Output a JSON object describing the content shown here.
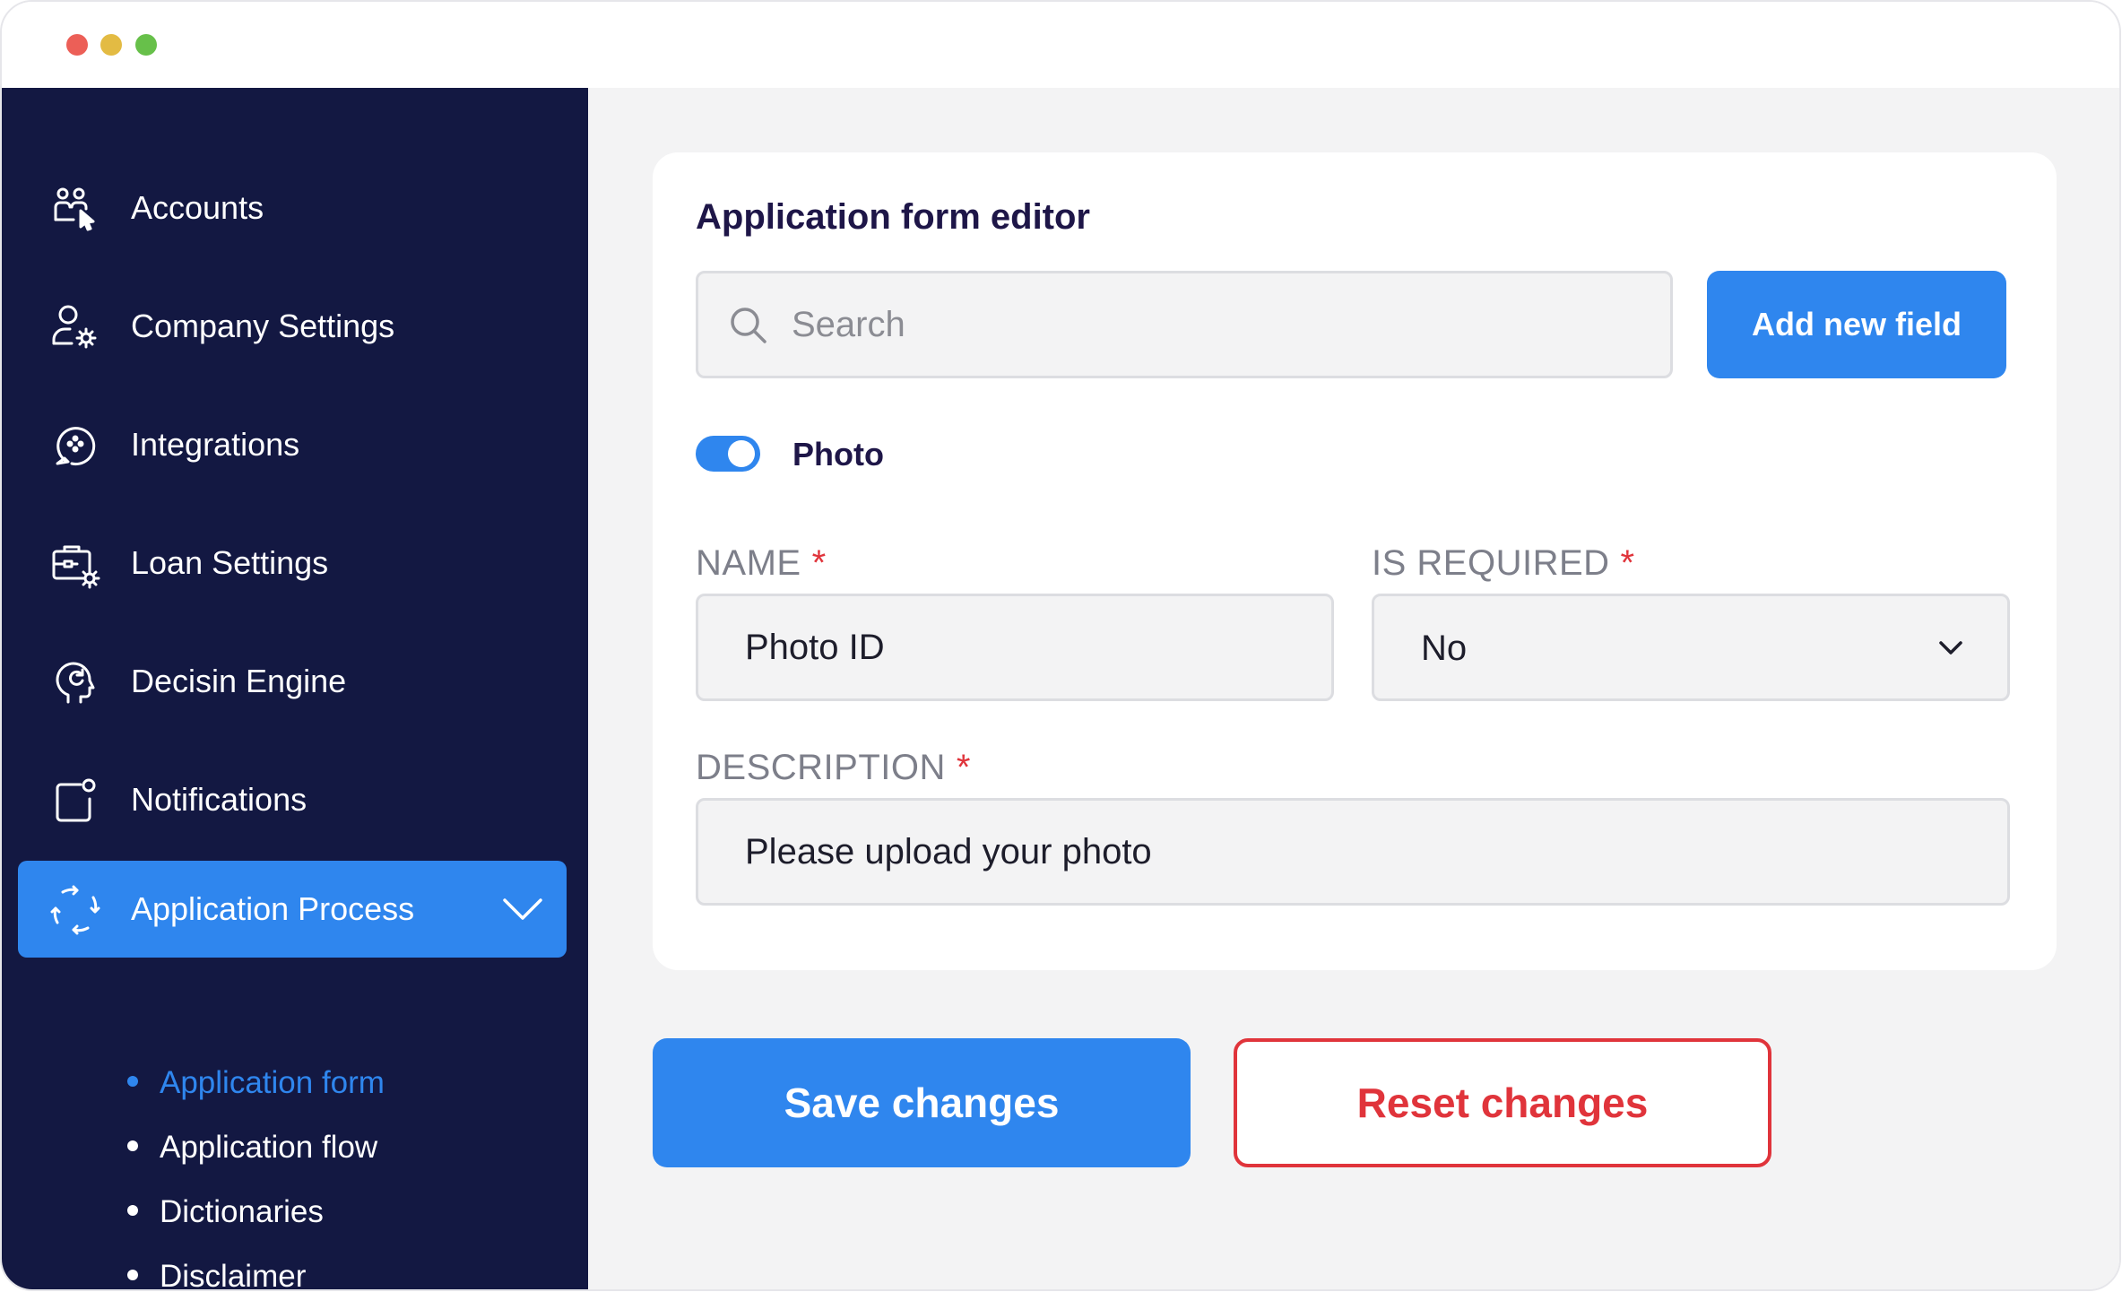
{
  "sidebar": {
    "items": [
      {
        "label": "Accounts",
        "icon": "users-cursor-icon"
      },
      {
        "label": "Company Settings",
        "icon": "user-gear-icon"
      },
      {
        "label": "Integrations",
        "icon": "integrations-icon"
      },
      {
        "label": "Loan Settings",
        "icon": "briefcase-gear-icon"
      },
      {
        "label": "Decisin Engine",
        "icon": "brain-head-icon"
      },
      {
        "label": "Notifications",
        "icon": "notification-icon"
      },
      {
        "label": "Application Process",
        "icon": "process-cycle-icon",
        "active": true,
        "expanded": true
      }
    ],
    "sub_items": [
      {
        "label": "Application form",
        "active": true
      },
      {
        "label": "Application flow"
      },
      {
        "label": "Dictionaries"
      },
      {
        "label": "Disclaimer"
      }
    ]
  },
  "editor": {
    "title": "Application form editor",
    "search": {
      "placeholder": "Search",
      "value": ""
    },
    "add_button": "Add new field",
    "toggle": {
      "label": "Photo",
      "on": true
    },
    "name": {
      "label": "NAME",
      "required_mark": "*",
      "value": "Photo ID"
    },
    "is_required": {
      "label": "IS REQUIRED",
      "required_mark": "*",
      "value": "No"
    },
    "description": {
      "label": "DESCRIPTION",
      "required_mark": "*",
      "value": "Please upload your photo"
    }
  },
  "actions": {
    "save": "Save changes",
    "reset": "Reset changes"
  },
  "colors": {
    "sidebar_bg": "#131842",
    "accent": "#2f86ee",
    "danger": "#e0343b",
    "main_bg": "#f3f3f4"
  }
}
